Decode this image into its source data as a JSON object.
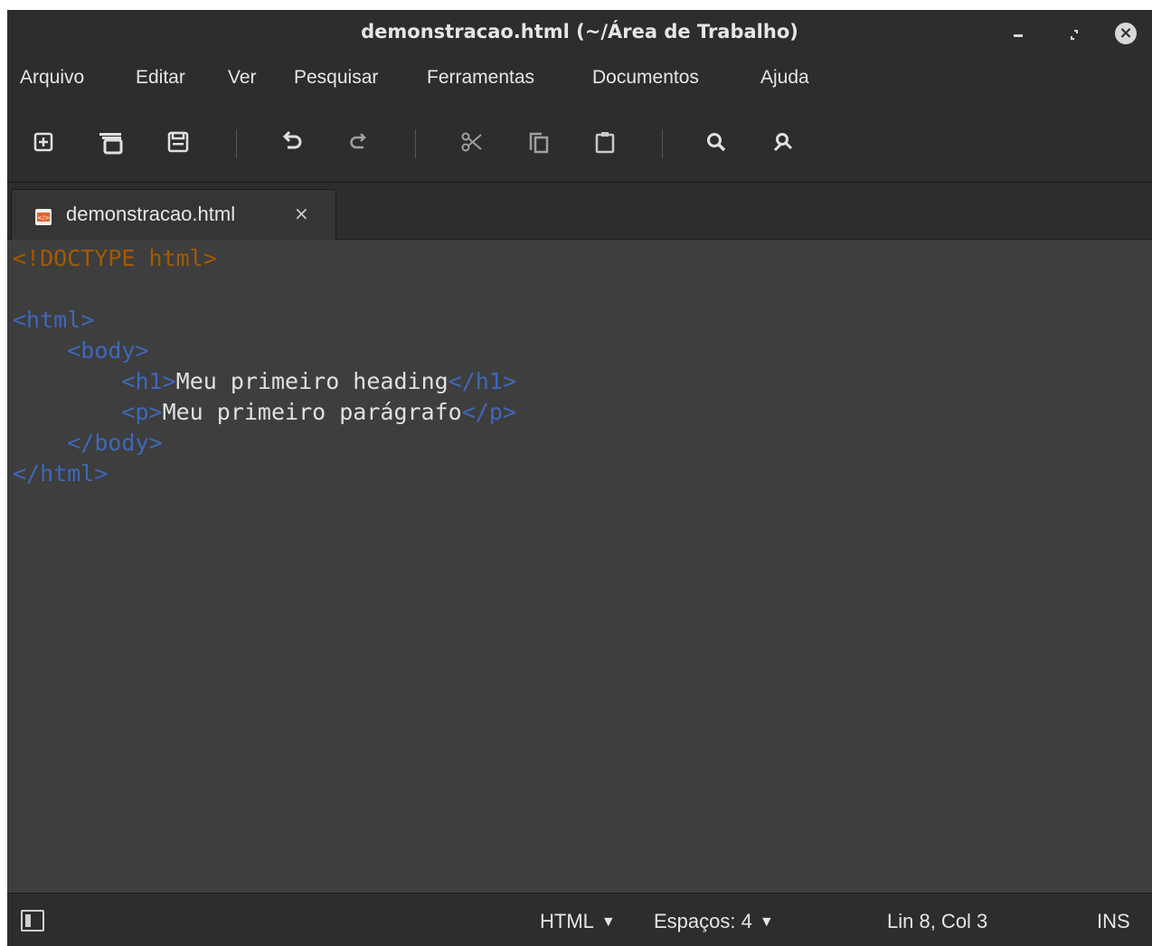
{
  "window": {
    "title": "demonstracao.html (~/Área de Trabalho)"
  },
  "menu": [
    "Arquivo",
    "Editar",
    "Ver",
    "Pesquisar",
    "Ferramentas",
    "Documentos",
    "Ajuda"
  ],
  "toolbar": {
    "icons": [
      "new-document-icon",
      "open-document-icon",
      "save-icon",
      "undo-icon",
      "redo-icon",
      "cut-icon",
      "copy-icon",
      "paste-icon",
      "search-icon",
      "replace-icon"
    ]
  },
  "tab": {
    "label": "demonstracao.html",
    "close": "×"
  },
  "code": {
    "doctype": "<!DOCTYPE html>",
    "html_open": "<html>",
    "body_open": "<body>",
    "h1_open": "<h1>",
    "h1_text": "Meu primeiro heading",
    "h1_close": "</h1>",
    "p_open": "<p>",
    "p_text": "Meu primeiro parágrafo",
    "p_close": "</p>",
    "body_close": "</body>",
    "html_close": "</html>"
  },
  "status": {
    "language": "HTML",
    "spaces": "Espaços: 4",
    "position": "Lin 8, Col 3",
    "mode": "INS"
  },
  "colors": {
    "doctype": "#a35a00",
    "tag": "#3d68b9",
    "text": "#e0e0e0",
    "editor_bg": "#3e3e3e",
    "chrome_bg": "#2d2d2d"
  }
}
